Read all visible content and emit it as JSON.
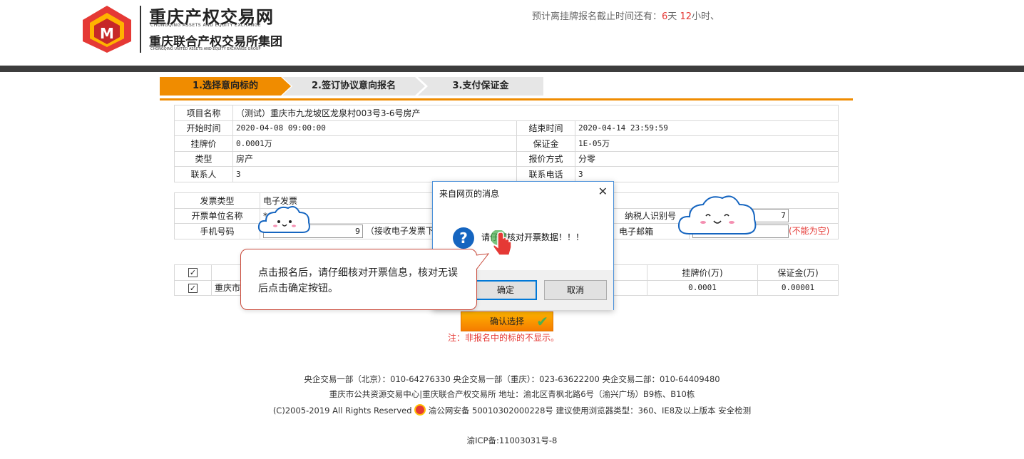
{
  "header": {
    "logo_cn1": "重庆产权交易网",
    "logo_en1": "CHONGQING ASSETS AND EQUITY EXCHANGE",
    "logo_cn2": "重庆联合产权交易所集团",
    "logo_en2": "CHONGQING UNITED ASSETS AND EQUITY EXCHANGE GROUP",
    "countdown_prefix": "预计离挂牌报名截止时间还有：",
    "countdown_days": "6",
    "countdown_days_unit": "天",
    "countdown_hours": "12",
    "countdown_hours_unit": "小时、"
  },
  "steps": [
    "1.选择意向标的",
    "2.签订协议意向报名",
    "3.支付保证金"
  ],
  "project": {
    "name_label": "项目名称",
    "name_value": "（测试）重庆市九龙坡区龙泉村003号3-6号房产",
    "start_label": "开始时间",
    "start_value": "2020-04-08 09:00:00",
    "end_label": "结束时间",
    "end_value": "2020-04-14 23:59:59",
    "price_label": "挂牌价",
    "price_value": "0.0001万",
    "deposit_label": "保证金",
    "deposit_value": "1E-05万",
    "type_label": "类型",
    "type_value": "房产",
    "quote_label": "报价方式",
    "quote_value": "分零",
    "contact_label": "联系人",
    "contact_value": "3",
    "phone_label": "联系电话",
    "phone_value": "3"
  },
  "invoice": {
    "type_label": "发票类型",
    "type_value": "电子发票",
    "unit_label": "开票单位名称",
    "unit_value": "*",
    "tax_label": "纳税人识别号",
    "tax_value": "7",
    "mobile_label": "手机号码",
    "mobile_value": "9",
    "mobile_note": "（接收电子发票下",
    "email_label": "电子邮箱",
    "email_note": "(不能为空)"
  },
  "selection": {
    "col_price": "挂牌价(万)",
    "col_deposit": "保证金(万)",
    "row_name": "重庆市",
    "row_price": "0.0001",
    "row_deposit": "0.00001"
  },
  "confirm_select": "确认选择",
  "note": "注：非报名中的标的不显示。",
  "dialog": {
    "title": "来自网页的消息",
    "close": "✕",
    "icon": "?",
    "message": "请仔细核对开票数据！！！",
    "ok": "确定",
    "cancel": "取消"
  },
  "bubble_text": "点击报名后，请仔细核对开票信息，核对无误后点击确定按钮。",
  "footer": {
    "line1": "央企交易一部（北京）：010-64276330   央企交易一部（重庆）：023-63622200   央企交易二部：010-64409480",
    "line2": "重庆市公共资源交易中心|重庆联合产权交易所 地址：渝北区青枫北路6号（渝兴广场）B9栋、B10栋",
    "line3a": "(C)2005-2019    All Rights Reserved",
    "line3b": "渝公网安备 50010302000228号  建议使用浏览器类型：360、IE8及以上版本 安全检测",
    "line4": "渝ICP备:11003031号-8"
  },
  "colors": {
    "accent": "#f08c00",
    "dark_bar": "#3d3d3d",
    "alert_red": "#e53935",
    "dialog_border": "#4a90d9"
  }
}
